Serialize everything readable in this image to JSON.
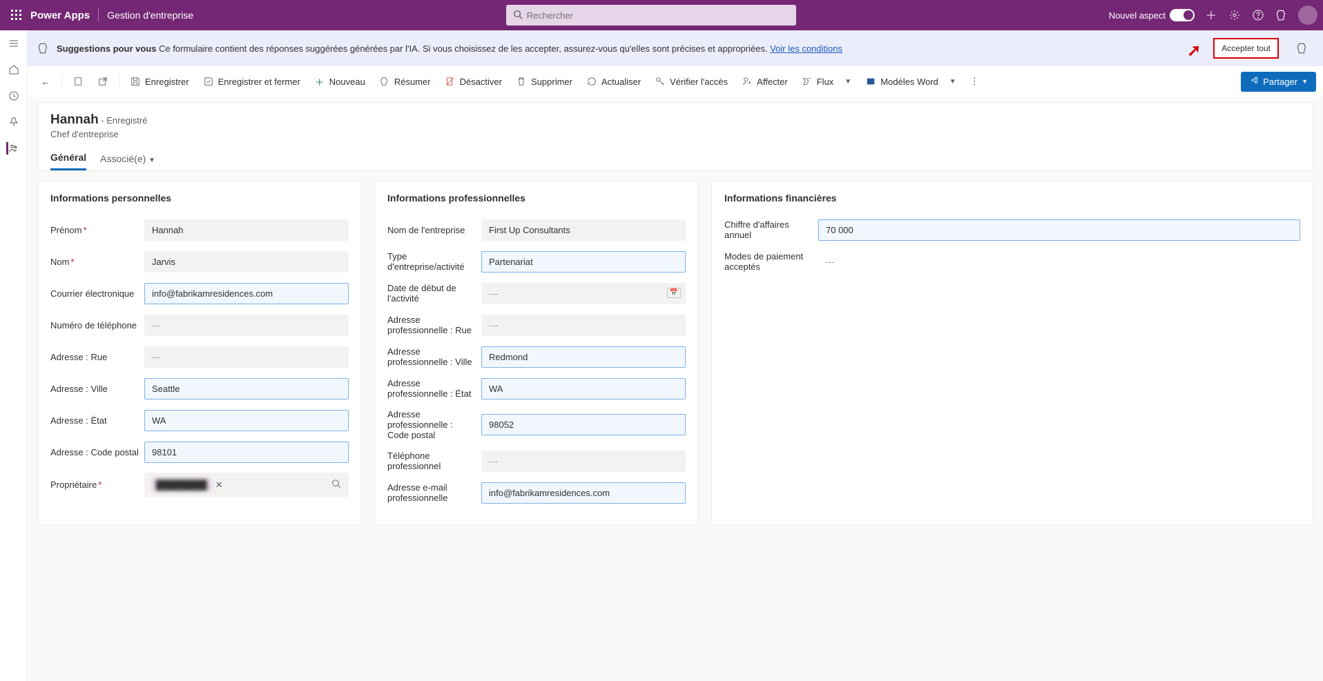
{
  "header": {
    "brand": "Power Apps",
    "environment": "Gestion d'entreprise",
    "search_placeholder": "Rechercher",
    "new_look_label": "Nouvel aspect"
  },
  "suggestion": {
    "title": "Suggestions pour vous",
    "body": "Ce formulaire contient des réponses suggérées générées par l'IA. Si vous choisissez de les accepter, assurez-vous qu'elles sont précises et appropriées.",
    "link": "Voir les conditions",
    "accept_all": "Accepter tout"
  },
  "commands": {
    "save": "Enregistrer",
    "save_close": "Enregistrer et fermer",
    "new": "Nouveau",
    "summarize": "Résumer",
    "deactivate": "Désactiver",
    "delete": "Supprimer",
    "refresh": "Actualiser",
    "check_access": "Vérifier l'accès",
    "assign": "Affecter",
    "flow": "Flux",
    "word": "Modèles Word",
    "share": "Partager"
  },
  "record": {
    "title": "Hannah",
    "status": "- Enregistré",
    "subtitle": "Chef d'entreprise",
    "tab_general": "Général",
    "tab_related": "Associé(e)"
  },
  "sections": {
    "personal": {
      "title": "Informations personnelles",
      "firstname_label": "Prénom",
      "firstname": "Hannah",
      "lastname_label": "Nom",
      "lastname": "Jarvis",
      "email_label": "Courrier électronique",
      "email": "info@fabrikamresidences.com",
      "phone_label": "Numéro de téléphone",
      "phone": "---",
      "street_label": "Adresse : Rue",
      "street": "---",
      "city_label": "Adresse : Ville",
      "city": "Seattle",
      "state_label": "Adresse : État",
      "state": "WA",
      "zip_label": "Adresse : Code postal",
      "zip": "98101",
      "owner_label": "Propriétaire"
    },
    "professional": {
      "title": "Informations professionnelles",
      "company_label": "Nom de l'entreprise",
      "company": "First Up Consultants",
      "biztype_label": "Type d'entreprise/activité",
      "biztype": "Partenariat",
      "startdate_label": "Date de début de l'activité",
      "startdate": "---",
      "bstreet_label": "Adresse professionnelle : Rue",
      "bstreet": "---",
      "bcity_label": "Adresse professionnelle : Ville",
      "bcity": "Redmond",
      "bstate_label": "Adresse professionnelle : État",
      "bstate": "WA",
      "bzip_label": "Adresse professionnelle : Code postal",
      "bzip": "98052",
      "bphone_label": "Téléphone professionnel",
      "bphone": "---",
      "bemail_label": "Adresse e-mail professionnelle",
      "bemail": "info@fabrikamresidences.com"
    },
    "financial": {
      "title": "Informations financières",
      "revenue_label": "Chiffre d'affaires annuel",
      "revenue": "70 000",
      "payment_label": "Modes de paiement acceptés",
      "payment": "---"
    }
  }
}
